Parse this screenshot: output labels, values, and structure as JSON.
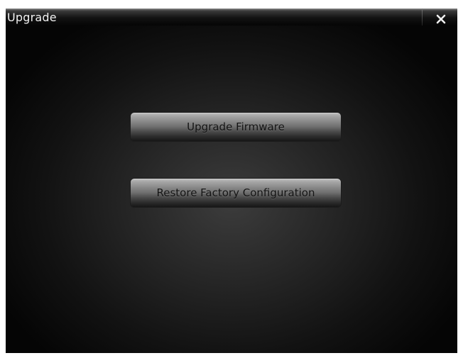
{
  "window": {
    "title": "Upgrade",
    "close_icon": "close-icon"
  },
  "buttons": {
    "upgrade_firmware": "Upgrade Firmware",
    "restore_factory": "Restore Factory Configuration"
  },
  "colors": {
    "background_center": "#3c3c3c",
    "background_edge": "#050505",
    "title_text": "#f2f2f2",
    "button_text": "#141414"
  }
}
